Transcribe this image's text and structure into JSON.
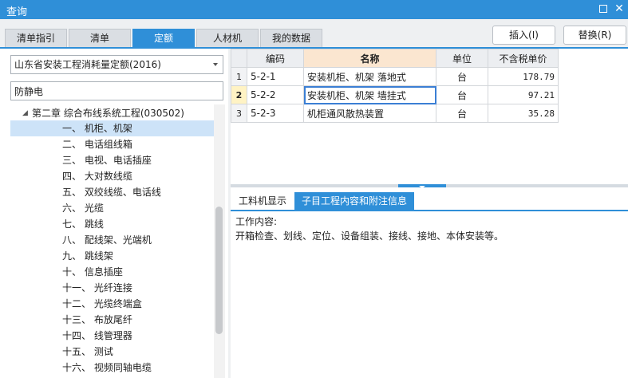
{
  "window": {
    "title": "查询",
    "maximize_glyph": "",
    "close_glyph": "✕"
  },
  "tabs": [
    {
      "label": "清单指引",
      "active": false
    },
    {
      "label": "清单",
      "active": false
    },
    {
      "label": "定额",
      "active": true
    },
    {
      "label": "人材机",
      "active": false
    },
    {
      "label": "我的数据",
      "active": false
    }
  ],
  "actions": {
    "insert_label": "插入(I)",
    "replace_label": "替换(R)"
  },
  "left": {
    "quota_library": "山东省安装工程消耗量定额(2016)",
    "search_value": "防静电",
    "search_placeholder": "",
    "tree": {
      "parent": {
        "label": "第二章 综合布线系统工程(030502)",
        "toggle_glyph": "◢"
      },
      "items": [
        {
          "label": "一、 机柜、机架",
          "selected": true
        },
        {
          "label": "二、 电话组线箱",
          "selected": false
        },
        {
          "label": "三、 电视、电话插座",
          "selected": false
        },
        {
          "label": "四、 大对数线缆",
          "selected": false
        },
        {
          "label": "五、 双绞线缆、电话线",
          "selected": false
        },
        {
          "label": "六、 光缆",
          "selected": false
        },
        {
          "label": "七、 跳线",
          "selected": false
        },
        {
          "label": "八、 配线架、光端机",
          "selected": false
        },
        {
          "label": "九、 跳线架",
          "selected": false
        },
        {
          "label": "十、 信息插座",
          "selected": false
        },
        {
          "label": "十一、 光纤连接",
          "selected": false
        },
        {
          "label": "十二、 光缆终端盒",
          "selected": false
        },
        {
          "label": "十三、 布放尾纤",
          "selected": false
        },
        {
          "label": "十四、 线管理器",
          "selected": false
        },
        {
          "label": "十五、 测试",
          "selected": false
        },
        {
          "label": "十六、 视频同轴电缆",
          "selected": false
        }
      ]
    }
  },
  "grid": {
    "headers": {
      "code": "编码",
      "name": "名称",
      "unit": "单位",
      "price": "不含税单价"
    },
    "rows": [
      {
        "num": "1",
        "code": "5-2-1",
        "name": "安装机柜、机架 落地式",
        "unit": "台",
        "price": "178.79",
        "current": false
      },
      {
        "num": "2",
        "code": "5-2-2",
        "name": "安装机柜、机架 墙挂式",
        "unit": "台",
        "price": "97.21",
        "current": true
      },
      {
        "num": "3",
        "code": "5-2-3",
        "name": "机柜通风散热装置",
        "unit": "台",
        "price": "35.28",
        "current": false
      }
    ]
  },
  "detail": {
    "tabs": [
      {
        "label": "工料机显示",
        "active": false
      },
      {
        "label": "子目工程内容和附注信息",
        "active": true
      }
    ],
    "content_label": "工作内容:",
    "content_text": "开箱检查、划线、定位、设备组装、接线、接地、本体安装等。"
  },
  "colors": {
    "accent": "#2f8fd8",
    "selected_row": "#cde3f8",
    "name_header": "#fbe6d0",
    "current_row_marker": "#fff3c4"
  }
}
